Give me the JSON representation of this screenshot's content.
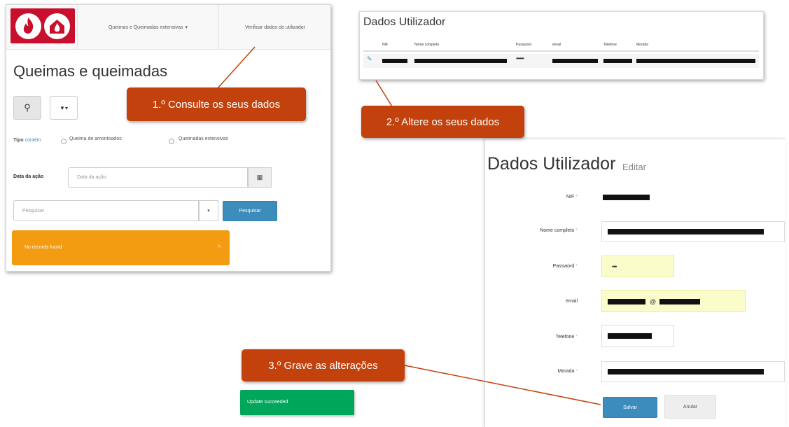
{
  "list_page": {
    "nav_menu_label": "Queimas e Queimadas extensivas",
    "nav_menu_caret": "▾",
    "nav_verify_label": "Verificar dados do utilizador",
    "title": "Queimas e queimadas",
    "search_icon": "⚲",
    "filter_icon": "▼▾",
    "tipo_label_prefix": "Tipo ",
    "tipo_label_op": "contém",
    "radio_options": [
      "Queima de amontoados",
      "Queimadas extensivas"
    ],
    "date_label": "Data da ação",
    "date_placeholder": "Data da ação",
    "calendar_icon": "▦",
    "search_placeholder": "Pesquisar",
    "search_caret": "▾",
    "search_button": "Pesquisar",
    "no_records": "No records found",
    "alert_close": "×"
  },
  "user_table": {
    "title": "Dados Utilizador",
    "columns": [
      "NIF",
      "Nome completo",
      "Password",
      "email",
      "Telefone",
      "Morada"
    ],
    "edit_icon": "✎",
    "password_mask": "••••••"
  },
  "edit_form": {
    "title": "Dados Utilizador",
    "subtitle": "Editar",
    "required_mark": "*",
    "fields": [
      {
        "label": "NIF"
      },
      {
        "label": "Nome completo"
      },
      {
        "label": "Password",
        "mask": "•••"
      },
      {
        "label": "email",
        "at": "@"
      },
      {
        "label": "Telefone"
      },
      {
        "label": "Morada"
      }
    ],
    "save_button": "Salvar",
    "cancel_button": "Anular"
  },
  "toast": "Update succeeded",
  "callouts": {
    "step1": "1.º Consulte os seus dados",
    "step2": "2.º Altere os seus dados",
    "step3": "3.º Grave as alterações"
  },
  "colors": {
    "brand_red": "#c8102e",
    "primary_blue": "#3c8dbc",
    "warning_orange": "#f39c12",
    "success_green": "#00a65a",
    "callout_orange": "#c2410c",
    "highlight_yellow": "#fafdc9"
  }
}
